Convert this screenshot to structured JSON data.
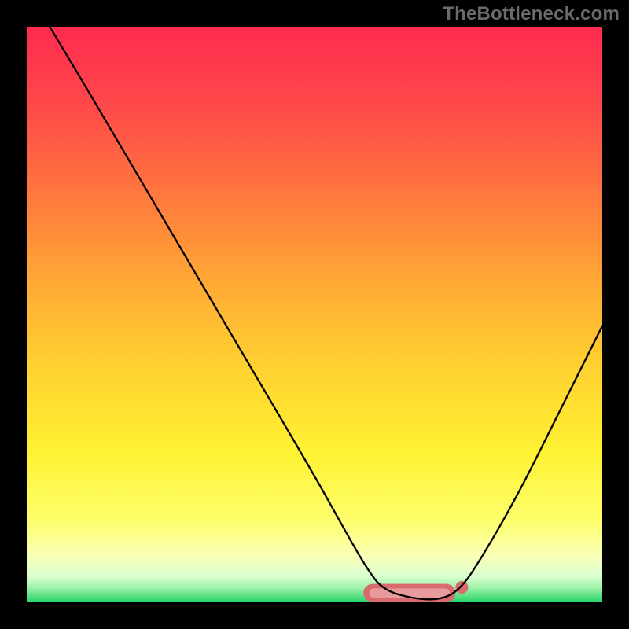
{
  "watermark": "TheBottleneck.com",
  "gradient_stops": [
    {
      "offset": 0.0,
      "color": "#ff2a4f"
    },
    {
      "offset": 0.14,
      "color": "#ff4a4a"
    },
    {
      "offset": 0.3,
      "color": "#ff7a3d"
    },
    {
      "offset": 0.45,
      "color": "#ffab35"
    },
    {
      "offset": 0.6,
      "color": "#ffd330"
    },
    {
      "offset": 0.74,
      "color": "#fff233"
    },
    {
      "offset": 0.86,
      "color": "#fdff6d"
    },
    {
      "offset": 0.92,
      "color": "#faffb8"
    },
    {
      "offset": 0.955,
      "color": "#d9ffd0"
    },
    {
      "offset": 0.975,
      "color": "#9ef2a8"
    },
    {
      "offset": 1.0,
      "color": "#25d36b"
    }
  ],
  "chart_data": {
    "type": "line",
    "title": "",
    "xlabel": "",
    "ylabel": "",
    "xlim": [
      0,
      100
    ],
    "ylim": [
      0,
      100
    ],
    "series": [
      {
        "name": "bottleneck-curve",
        "color": "#000000",
        "x": [
          4,
          10,
          20,
          30,
          40,
          50,
          55,
          59,
          62,
          68,
          72,
          75,
          78,
          85,
          92,
          100
        ],
        "y": [
          100,
          90,
          73,
          56,
          39,
          22,
          13,
          6,
          2,
          0.5,
          0.5,
          2,
          6,
          18,
          32,
          48
        ]
      }
    ],
    "markers": [
      {
        "name": "flat-region-outline",
        "shape": "roundrect",
        "color": "#d96a6e",
        "x0": 58.5,
        "x1": 74.5,
        "y": 1.6,
        "thickness": 3.2,
        "radius": 1.6
      },
      {
        "name": "flat-region-fill",
        "shape": "roundrect",
        "color": "#e89a9d",
        "x0": 59.5,
        "x1": 73.5,
        "y": 1.6,
        "thickness": 1.6,
        "radius": 0.8
      },
      {
        "name": "end-dot",
        "shape": "circle",
        "color": "#d96a6e",
        "cx": 75.6,
        "cy": 2.6,
        "r": 1.1
      }
    ]
  }
}
